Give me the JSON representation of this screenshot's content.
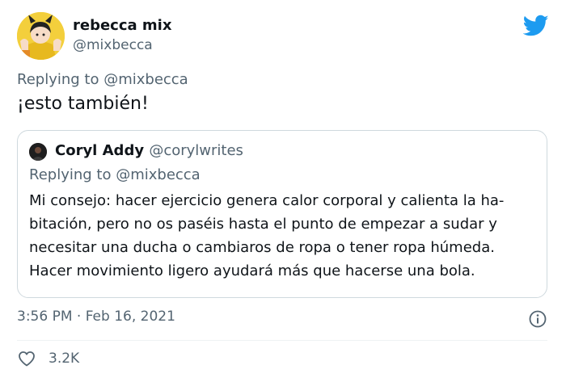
{
  "author": {
    "display_name": "rebecca mix",
    "handle": "@mixbecca"
  },
  "tweet": {
    "replying_prefix": "Replying to ",
    "replying_handle": "@mixbecca",
    "text": "¡esto también!",
    "timestamp": "3:56 PM · Feb 16, 2021",
    "likes": "3.2K"
  },
  "quote": {
    "display_name": "Coryl Addy",
    "handle": "@corylwrites",
    "replying_prefix": "Replying to ",
    "replying_handle": "@mixbecca",
    "body_lines": [
      "Mi consejo: hacer ejercicio genera calor corporal y calienta la ha-",
      "bitación, pero no os paséis hasta el punto de empezar a sudar y",
      "necesitar una ducha o cambiaros de ropa o tener ropa húmeda.",
      "Hacer movimiento ligero ayudará más que hacerse una bola."
    ]
  },
  "icons": {
    "brand": "twitter-bird-icon",
    "info": "info-icon",
    "like": "heart-icon"
  },
  "colors": {
    "brand": "#1d9bf0",
    "text": "#0f1419",
    "muted": "#536471",
    "border": "#cfd9de"
  }
}
